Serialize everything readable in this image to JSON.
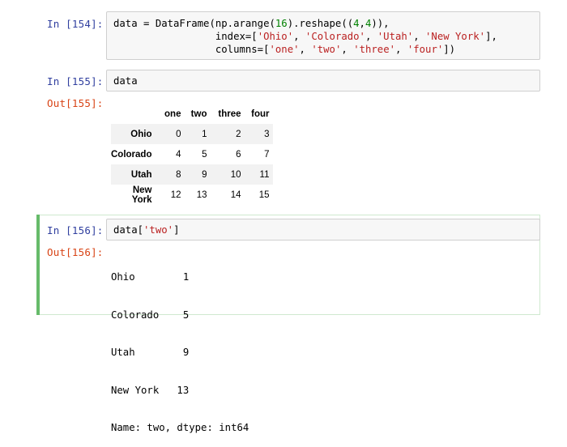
{
  "cells": [
    {
      "in_prompt": "In [154]:",
      "code_lines": [
        [
          "data = DataFrame(np.arange(",
          "16",
          ").reshape((",
          "4",
          ",",
          "4",
          ")),"
        ],
        [
          "                 index=[",
          "'Ohio'",
          ", ",
          "'Colorado'",
          ", ",
          "'Utah'",
          ", ",
          "'New York'",
          "],"
        ],
        [
          "                 columns=[",
          "'one'",
          ", ",
          "'two'",
          ", ",
          "'three'",
          ", ",
          "'four'",
          "])"
        ]
      ]
    },
    {
      "in_prompt": "In [155]:",
      "code": "data",
      "out_prompt": "Out[155]:",
      "table": {
        "columns": [
          "one",
          "two",
          "three",
          "four"
        ],
        "rows": [
          {
            "index": "Ohio",
            "values": [
              "0",
              "1",
              "2",
              "3"
            ]
          },
          {
            "index": "Colorado",
            "values": [
              "4",
              "5",
              "6",
              "7"
            ]
          },
          {
            "index": "Utah",
            "values": [
              "8",
              "9",
              "10",
              "11"
            ]
          },
          {
            "index": "New York",
            "values": [
              "12",
              "13",
              "14",
              "15"
            ]
          }
        ]
      }
    },
    {
      "in_prompt": "In [156]:",
      "code_prefix": "data[",
      "code_string": "'two'",
      "code_suffix": "]",
      "out_prompt": "Out[156]:",
      "series_lines": [
        "Ohio        1",
        "Colorado    5",
        "Utah        9",
        "New York   13",
        "Name: two, dtype: int64"
      ]
    }
  ]
}
